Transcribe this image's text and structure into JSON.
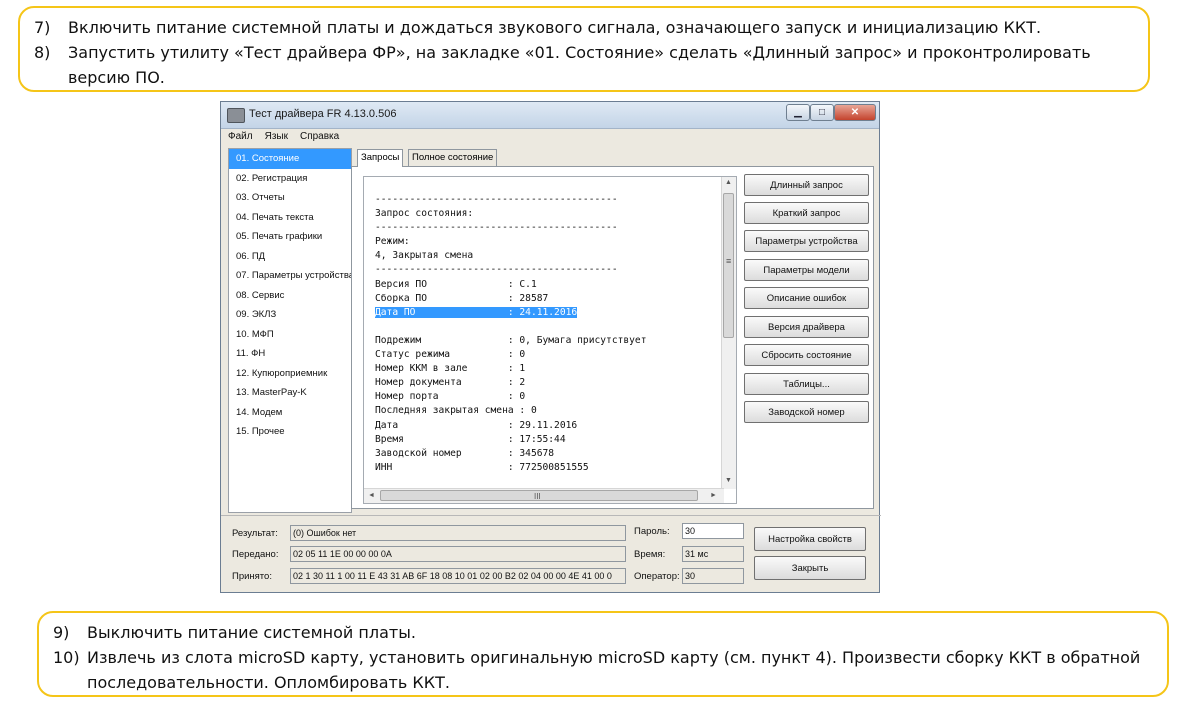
{
  "top_note": {
    "steps": [
      {
        "num": "7)",
        "text": "Включить питание системной платы и дождаться звукового сигнала, означающего запуск и инициализацию ККТ."
      },
      {
        "num": "8)",
        "text": "Запустить утилиту «Тест драйвера ФР», на закладке «01. Состояние» сделать «Длинный запрос» и проконтролировать"
      }
    ],
    "continuation": "версию ПО."
  },
  "window": {
    "title": "Тест драйвера FR 4.13.0.506",
    "controls": {
      "minimize": "▁",
      "maximize": "□",
      "close": "✕"
    },
    "menu": [
      "Файл",
      "Язык",
      "Справка"
    ],
    "sidebar": [
      "01. Состояние",
      "02. Регистрация",
      "03. Отчеты",
      "04. Печать текста",
      "05. Печать графики",
      "06. ПД",
      "07. Параметры устройства",
      "08. Сервис",
      "09. ЭКЛЗ",
      "10. МФП",
      "11. ФН",
      "12. Купюроприемник",
      "13. MasterPay-K",
      "14. Модем",
      "15. Прочее"
    ],
    "selected_sidebar_index": 0,
    "tabs": [
      "Запросы",
      "Полное состояние"
    ],
    "log_lines": [
      "------------------------------------------",
      "Запрос состояния:",
      "------------------------------------------",
      "Режим:",
      "4, Закрытая смена",
      "------------------------------------------",
      "Версия ПО              : C.1",
      "Сборка ПО              : 28587",
      "Дата ПО                : 24.11.2016",
      "",
      "Подрежим               : 0, Бумага присутствует",
      "Статус режима          : 0",
      "Номер ККМ в зале       : 1",
      "Номер документа        : 2",
      "Номер порта            : 0",
      "Последняя закрытая смена : 0",
      "Дата                   : 29.11.2016",
      "Время                  : 17:55:44",
      "Заводской номер        : 345678",
      "ИНН                    : 772500851555"
    ],
    "highlighted_line_index": 8,
    "scroll_grip": "III",
    "scroll_arrows": {
      "up": "▲",
      "down": "▼",
      "left": "◄",
      "right": "►",
      "grip": "≡"
    },
    "buttons": [
      "Длинный запрос",
      "Краткий запрос",
      "Параметры устройства",
      "Параметры модели",
      "Описание ошибок",
      "Версия драйвера",
      "Сбросить состояние",
      "Таблицы...",
      "Заводской номер"
    ],
    "status": {
      "result_label": "Результат:",
      "result_value": "(0) Ошибок нет",
      "sent_label": "Передано:",
      "sent_value": "02 05 11 1E 00 00 00 0A",
      "received_label": "Принято:",
      "received_value": "02 1 30 11 1 00 11 E 43 31 AB 6F 18 08 10 01 02 00 B2 02 04 00 00 4E 41 00 0",
      "password_label": "Пароль:",
      "password_value": "30",
      "time_label": "Время:",
      "time_value": "31 мс",
      "operator_label": "Оператор:",
      "operator_value": "30"
    },
    "bottom_buttons": [
      "Настройка свойств",
      "Закрыть"
    ]
  },
  "bottom_note": {
    "steps": [
      {
        "num": "9)",
        "text": "Выключить питание системной платы."
      },
      {
        "num": "10)",
        "text": "Извлечь из слота microSD карту, установить оригинальную microSD карту (см. пункт 4). Произвести сборку ККТ в обратной"
      }
    ],
    "continuation": "последовательности. Опломбировать ККТ."
  },
  "colors": {
    "note_border": "#f5c518",
    "selection": "#3399ff"
  }
}
